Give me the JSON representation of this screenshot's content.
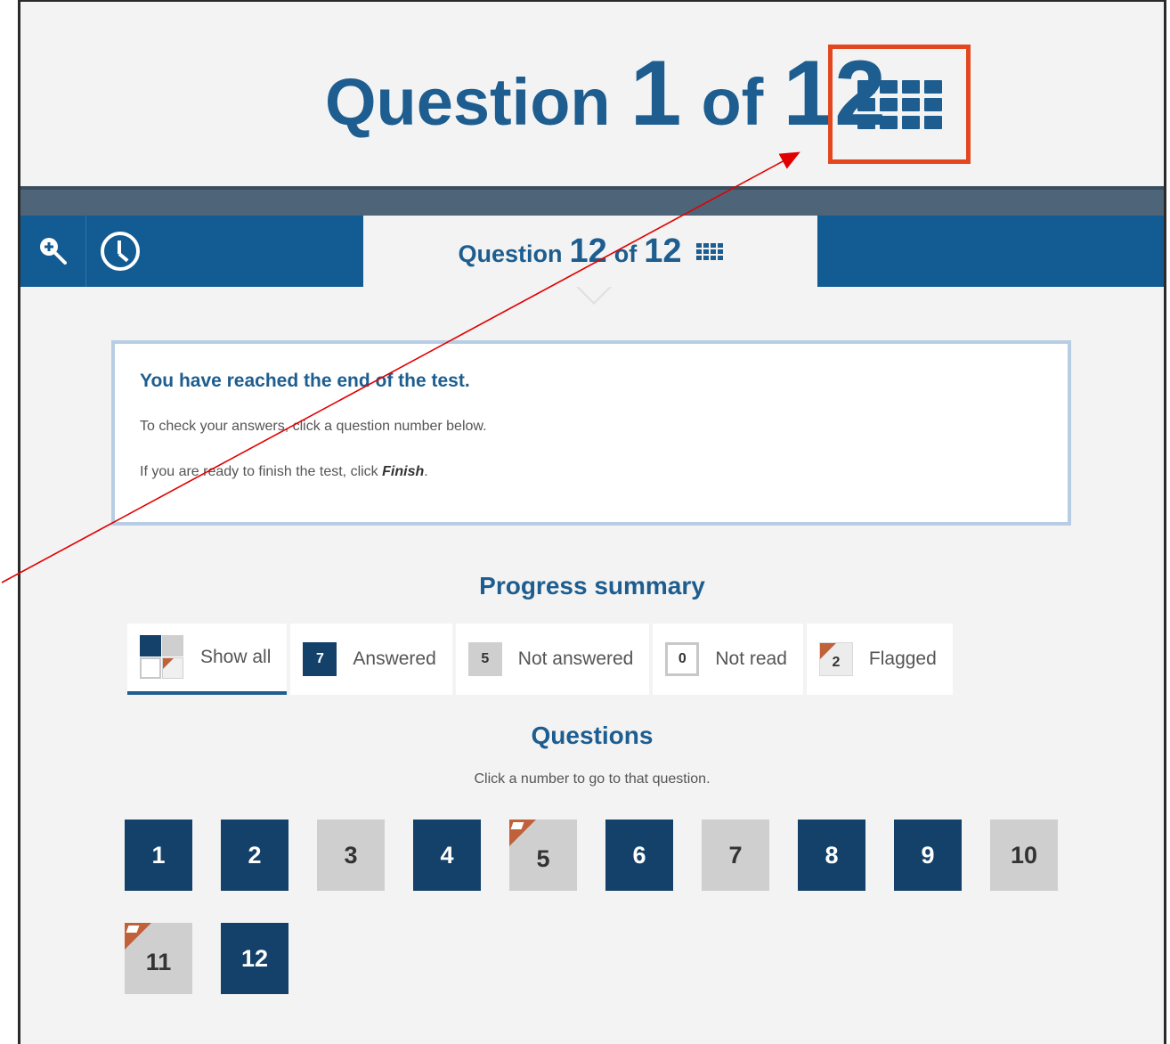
{
  "zoomed_header": {
    "word_question": "Question",
    "current": "1",
    "word_of": "of",
    "total": "12"
  },
  "toolbar": {
    "zoom_icon": "zoom-in-icon",
    "clock_icon": "clock-icon",
    "tab": {
      "word_question": "Question",
      "current": "12",
      "word_of": "of",
      "total": "12",
      "icon": "grid-icon"
    }
  },
  "message": {
    "title": "You have reached the end of the test.",
    "line1": "To check your answers, click a question number below.",
    "line2_prefix": "If you are ready to finish the test, click ",
    "line2_finish": "Finish",
    "line2_suffix": "."
  },
  "progress": {
    "title": "Progress summary",
    "filters": [
      {
        "label": "Show all",
        "count": ""
      },
      {
        "label": "Answered",
        "count": "7"
      },
      {
        "label": "Not answered",
        "count": "5"
      },
      {
        "label": "Not read",
        "count": "0"
      },
      {
        "label": "Flagged",
        "count": "2"
      }
    ]
  },
  "questions": {
    "title": "Questions",
    "instruction": "Click a number to go to that question.",
    "items": [
      {
        "number": "1",
        "status": "answered",
        "flagged": false
      },
      {
        "number": "2",
        "status": "answered",
        "flagged": false
      },
      {
        "number": "3",
        "status": "unanswered",
        "flagged": false
      },
      {
        "number": "4",
        "status": "answered",
        "flagged": false
      },
      {
        "number": "5",
        "status": "unanswered",
        "flagged": true
      },
      {
        "number": "6",
        "status": "answered",
        "flagged": false
      },
      {
        "number": "7",
        "status": "unanswered",
        "flagged": false
      },
      {
        "number": "8",
        "status": "answered",
        "flagged": false
      },
      {
        "number": "9",
        "status": "answered",
        "flagged": false
      },
      {
        "number": "10",
        "status": "unanswered",
        "flagged": false
      },
      {
        "number": "11",
        "status": "unanswered",
        "flagged": true
      },
      {
        "number": "12",
        "status": "answered",
        "flagged": false
      }
    ]
  },
  "colors": {
    "brand_blue": "#125b93",
    "answered": "#14416a",
    "unanswered": "#cfcfcf",
    "flag": "#c0613a",
    "highlight_box": "#e2471f",
    "annotation_arrow": "#e00000"
  }
}
